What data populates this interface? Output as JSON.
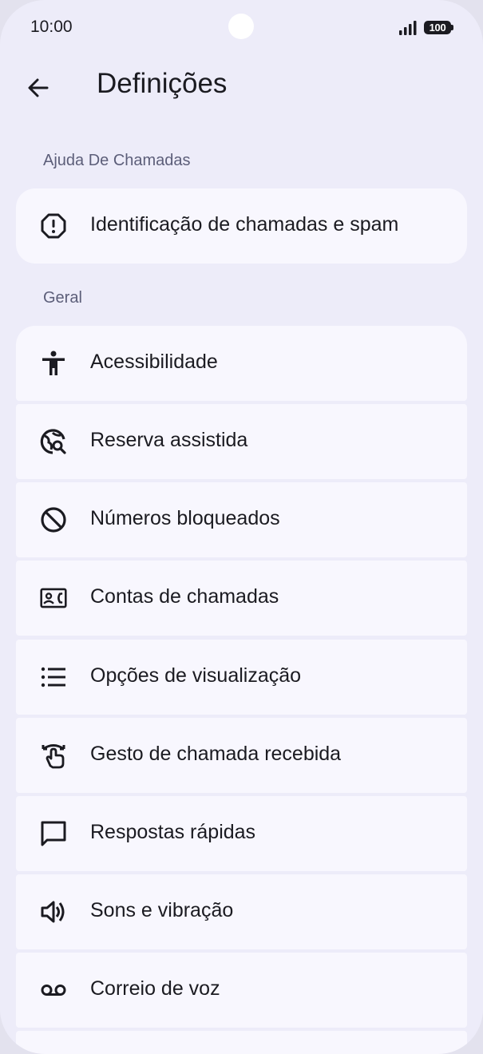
{
  "status_bar": {
    "time": "10:00",
    "battery": "100"
  },
  "header": {
    "title": "Definições"
  },
  "sections": [
    {
      "title": "Ajuda De Chamadas",
      "items": [
        {
          "label": "Identificação de chamadas e spam",
          "icon": "spam-alert-icon"
        }
      ]
    },
    {
      "title": "Geral",
      "items": [
        {
          "label": "Acessibilidade",
          "icon": "accessibility-icon"
        },
        {
          "label": "Reserva assistida",
          "icon": "globe-search-icon"
        },
        {
          "label": "Números bloqueados",
          "icon": "block-icon"
        },
        {
          "label": "Contas de chamadas",
          "icon": "contact-card-phone-icon"
        },
        {
          "label": "Opções de visualização",
          "icon": "list-icon"
        },
        {
          "label": "Gesto de chamada recebida",
          "icon": "swipe-gesture-icon"
        },
        {
          "label": "Respostas rápidas",
          "icon": "chat-bubble-icon"
        },
        {
          "label": "Sons e vibração",
          "icon": "volume-icon"
        },
        {
          "label": "Correio de voz",
          "icon": "voicemail-icon"
        }
      ]
    }
  ]
}
